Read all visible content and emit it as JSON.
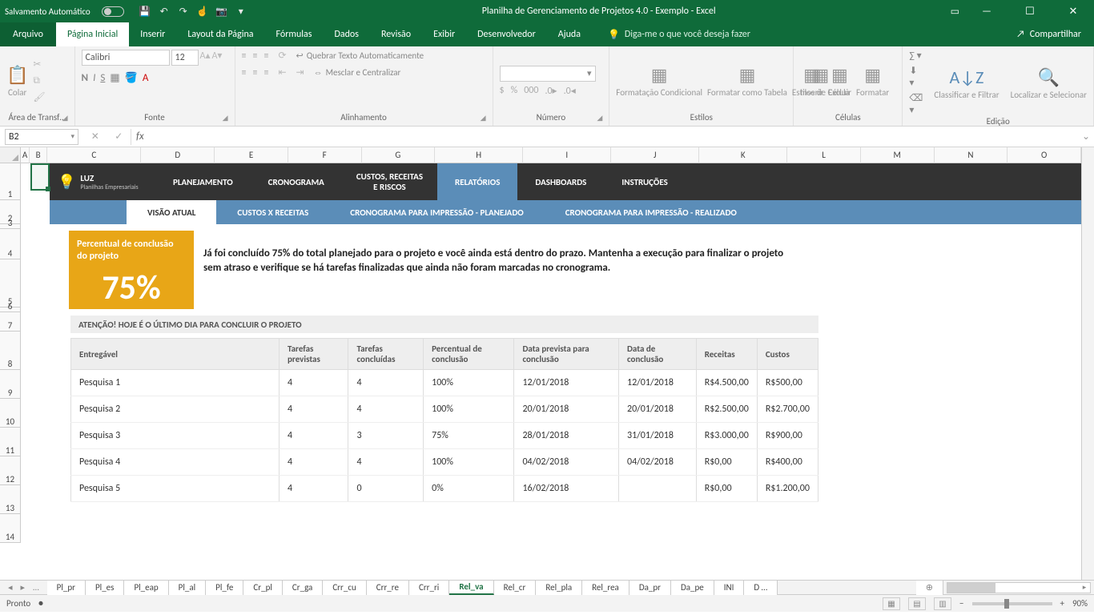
{
  "titlebar": {
    "autosave": "Salvamento Automático",
    "title": "Planilha de Gerenciamento de Projetos 4.0 - Exemplo  -  Excel"
  },
  "menu": {
    "file": "Arquivo",
    "tabs": [
      "Página Inicial",
      "Inserir",
      "Layout da Página",
      "Fórmulas",
      "Dados",
      "Revisão",
      "Exibir",
      "Desenvolvedor",
      "Ajuda"
    ],
    "tellme": "Diga-me o que você deseja fazer",
    "share": "Compartilhar"
  },
  "ribbon": {
    "clipboard": {
      "paste": "Colar",
      "group": "Área de Transf…"
    },
    "font": {
      "name": "Calibri",
      "size": "12",
      "group": "Fonte"
    },
    "alignment": {
      "wrap": "Quebrar Texto Automaticamente",
      "merge": "Mesclar e Centralizar",
      "group": "Alinhamento"
    },
    "number": {
      "group": "Número"
    },
    "styles": {
      "condfmt": "Formatação Condicional",
      "astable": "Formatar como Tabela",
      "cellstyles": "Estilos de Célula",
      "group": "Estilos"
    },
    "cells": {
      "insert": "Inserir",
      "delete": "Excluir",
      "format": "Formatar",
      "group": "Células"
    },
    "editing": {
      "sort": "Classificar e Filtrar",
      "find": "Localizar e Selecionar",
      "group": "Edição"
    }
  },
  "namebox": "B2",
  "columns": [
    "A",
    "B",
    "C",
    "D",
    "E",
    "F",
    "G",
    "H",
    "I",
    "J",
    "K",
    "L",
    "M",
    "N",
    "O"
  ],
  "rows": [
    "1",
    "2",
    "3",
    "4",
    "5",
    "6",
    "7",
    "8",
    "9",
    "10",
    "11",
    "12",
    "13",
    "14"
  ],
  "appnav": {
    "logo": "LUZ",
    "logosub": "Planilhas Empresariais",
    "items": [
      "PLANEJAMENTO",
      "CRONOGRAMA",
      "CUSTOS, RECEITAS E RISCOS",
      "RELATÓRIOS",
      "DASHBOARDS",
      "INSTRUÇÕES"
    ]
  },
  "subnav": [
    "VISÃO ATUAL",
    "CUSTOS X RECEITAS",
    "CRONOGRAMA PARA IMPRESSÃO - PLANEJADO",
    "CRONOGRAMA PARA IMPRESSÃO - REALIZADO"
  ],
  "kpi": {
    "label": "Percentual de conclusão do projeto",
    "value": "75%"
  },
  "kpitext": "Já foi concluído 75% do total planejado para o projeto e você ainda está dentro do prazo. Mantenha a execução para finalizar o projeto sem atraso e verifique se há tarefas finalizadas que ainda não foram marcadas no cronograma.",
  "alert": "ATENÇÃO! HOJE É O ÚLTIMO DIA PARA CONCLUIR O PROJETO",
  "table": {
    "headers": [
      "Entregável",
      "Tarefas previstas",
      "Tarefas concluídas",
      "Percentual de conclusão",
      "Data prevista para conclusão",
      "Data de conclusão",
      "Receitas",
      "Custos"
    ],
    "rows": [
      [
        "Pesquisa 1",
        "4",
        "4",
        "100%",
        "12/01/2018",
        "12/01/2018",
        "R$4.500,00",
        "R$500,00"
      ],
      [
        "Pesquisa 2",
        "4",
        "4",
        "100%",
        "20/01/2018",
        "20/01/2018",
        "R$2.500,00",
        "R$2.700,00"
      ],
      [
        "Pesquisa 3",
        "4",
        "3",
        "75%",
        "28/01/2018",
        "31/01/2018",
        "R$3.000,00",
        "R$900,00"
      ],
      [
        "Pesquisa 4",
        "4",
        "4",
        "100%",
        "04/02/2018",
        "04/02/2018",
        "R$0,00",
        "R$400,00"
      ],
      [
        "Pesquisa 5",
        "4",
        "0",
        "0%",
        "16/02/2018",
        "",
        "R$0,00",
        "R$1.200,00"
      ]
    ]
  },
  "sheettabs": [
    "Pl_pr",
    "Pl_es",
    "Pl_eap",
    "Pl_al",
    "Pl_fe",
    "Cr_pl",
    "Cr_ga",
    "Crr_cu",
    "Crr_re",
    "Crr_ri",
    "Rel_va",
    "Rel_cr",
    "Rel_pla",
    "Rel_rea",
    "Da_pr",
    "Da_pe",
    "INI",
    "D …"
  ],
  "activeSheet": "Rel_va",
  "status": {
    "ready": "Pronto",
    "zoom": "90%"
  }
}
